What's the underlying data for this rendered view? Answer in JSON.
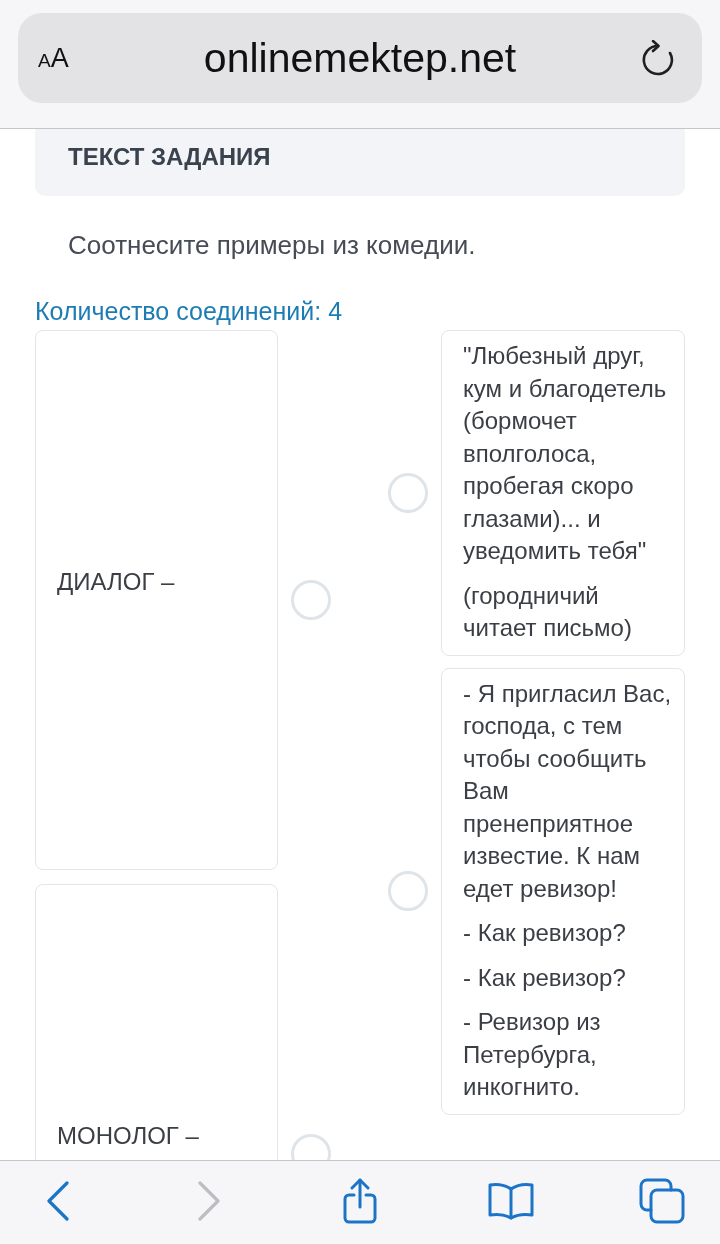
{
  "browser": {
    "text_size_label": "AA",
    "url": "onlinemektep.net"
  },
  "task": {
    "header": "ТЕКСТ ЗАДАНИЯ",
    "instruction": "Соотнесите примеры из комедии.",
    "connections_label": "Количество соединений: 4"
  },
  "left_items": [
    {
      "text": "ДИАЛОГ –"
    },
    {
      "text": "МОНОЛОГ –"
    }
  ],
  "right_items": [
    {
      "paragraphs": [
        "\"Любезный друг, кум и благодетель (бормочет вполголоса, пробегая скоро глазами)... и уведомить тебя\"",
        "(городничий читает письмо)"
      ]
    },
    {
      "paragraphs": [
        "- Я пригласил Вас, господа, с тем чтобы сообщить Вам пренеприятное известие. К нам едет ревизор!",
        "- Как ревизор?",
        "- Как ревизор?",
        "- Ревизор из Петербурга, инкогнито."
      ]
    }
  ],
  "toolbar": [
    {
      "kind": "back",
      "disabled": false
    },
    {
      "kind": "forward",
      "disabled": true
    },
    {
      "kind": "share",
      "disabled": false
    },
    {
      "kind": "bookmarks",
      "disabled": false
    },
    {
      "kind": "tabs",
      "disabled": false
    }
  ]
}
